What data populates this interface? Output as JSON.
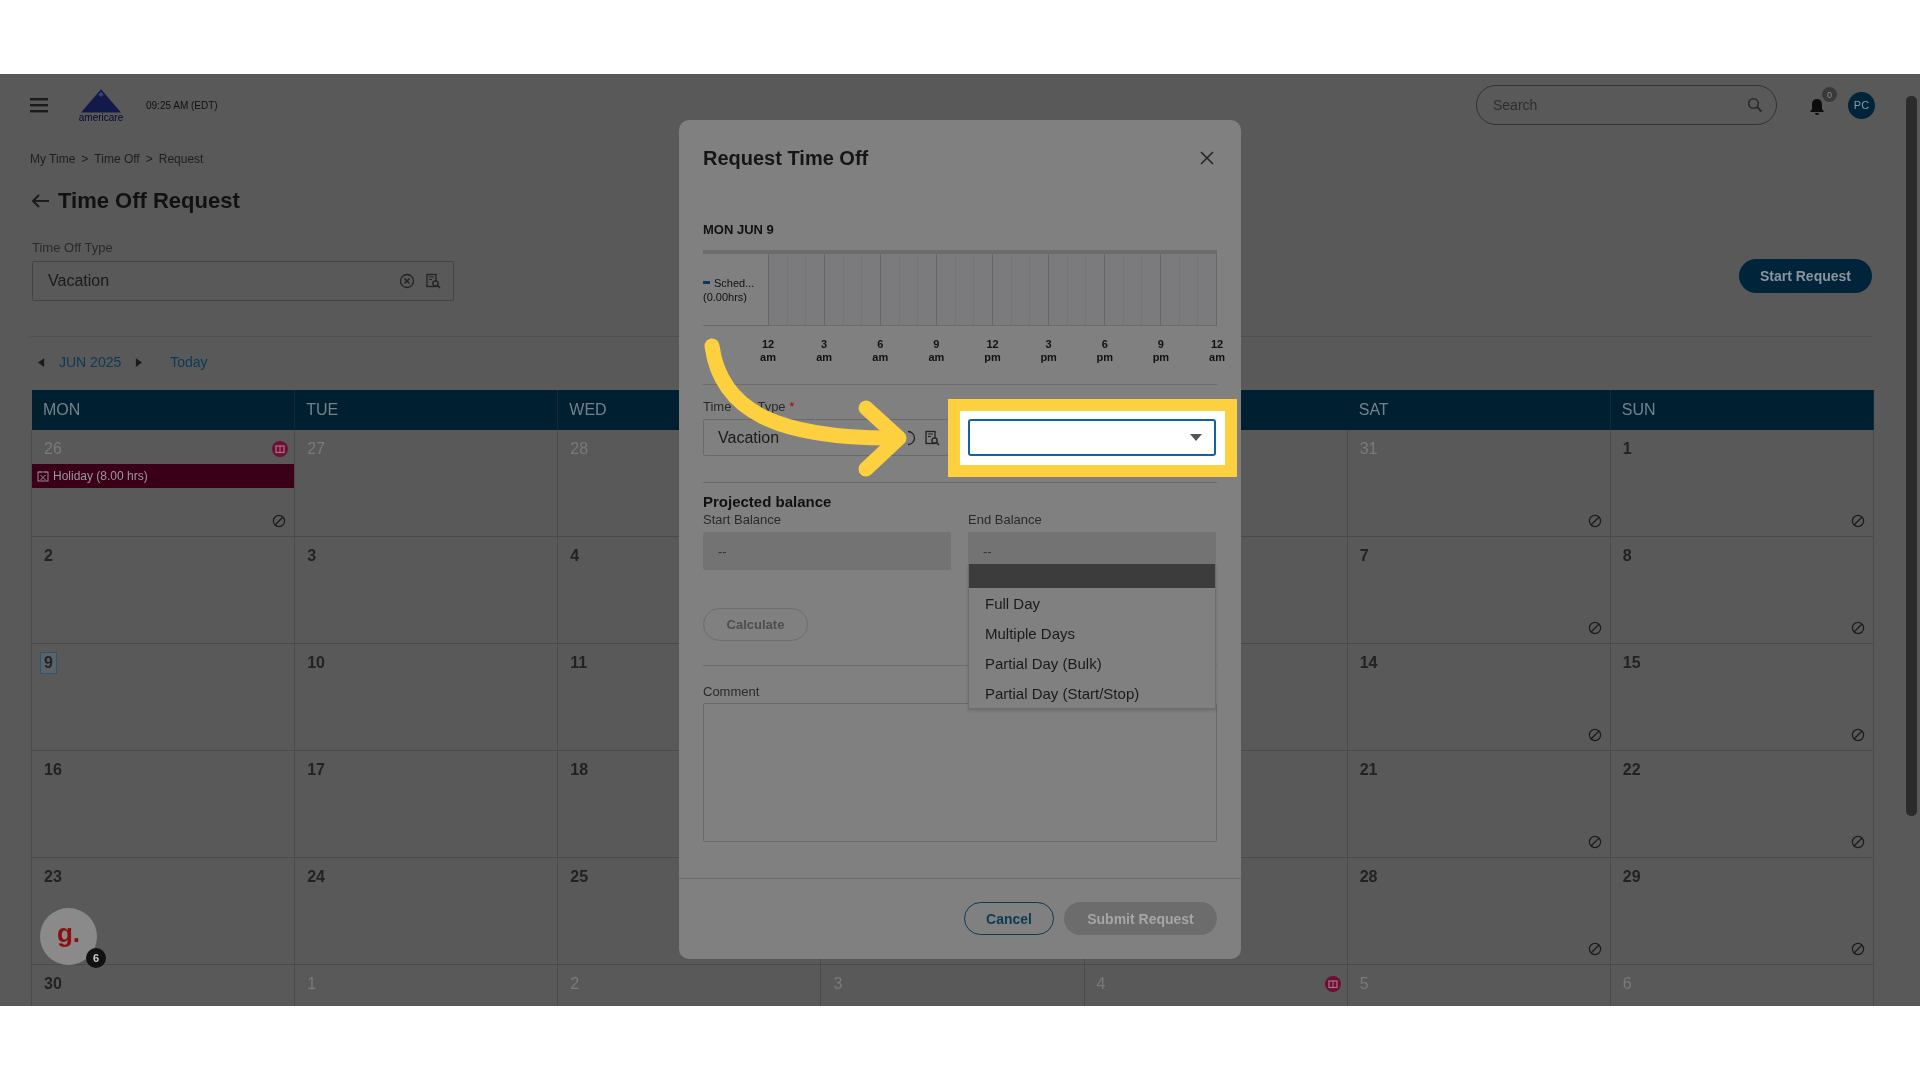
{
  "header": {
    "time": "09:25 AM (EDT)",
    "logo_text": "americare",
    "search": {
      "placeholder": "Search"
    },
    "notifications": "0",
    "avatar": "PC"
  },
  "breadcrumb": {
    "separator": ">",
    "items": [
      "My Time",
      "Time Off",
      "Request"
    ]
  },
  "page": {
    "title": "Time Off Request",
    "type_label": "Time Off Type",
    "type_value": "Vacation",
    "start_button": "Start Request"
  },
  "calendar": {
    "month": "JUN 2025",
    "today": "Today",
    "weekdays": [
      "MON",
      "TUE",
      "WED",
      "SAT",
      "SUN"
    ],
    "weeks": [
      [
        {
          "date": "26",
          "other_month": true,
          "selected": false,
          "blocked": true,
          "holiday": true,
          "event": "Holiday (8.00 hrs)"
        },
        {
          "date": "27",
          "other_month": true,
          "selected": false,
          "blocked": false,
          "holiday": false
        },
        {
          "date": "28",
          "other_month": true,
          "selected": false,
          "blocked": false,
          "holiday": false
        },
        {
          "date": "31",
          "other_month": true,
          "selected": false,
          "blocked": true,
          "holiday": false
        },
        {
          "date": "1",
          "other_month": false,
          "selected": false,
          "blocked": true,
          "holiday": false
        }
      ],
      [
        {
          "date": "2",
          "other_month": false,
          "selected": false,
          "blocked": false,
          "holiday": false
        },
        {
          "date": "3",
          "other_month": false,
          "selected": false,
          "blocked": false,
          "holiday": false
        },
        {
          "date": "4",
          "other_month": false,
          "selected": false,
          "blocked": false,
          "holiday": false
        },
        {
          "date": "7",
          "other_month": false,
          "selected": false,
          "blocked": true,
          "holiday": false
        },
        {
          "date": "8",
          "other_month": false,
          "selected": false,
          "blocked": true,
          "holiday": false
        }
      ],
      [
        {
          "date": "9",
          "other_month": false,
          "selected": true,
          "blocked": false,
          "holiday": false
        },
        {
          "date": "10",
          "other_month": false,
          "selected": false,
          "blocked": false,
          "holiday": false
        },
        {
          "date": "11",
          "other_month": false,
          "selected": false,
          "blocked": false,
          "holiday": false
        },
        {
          "date": "14",
          "other_month": false,
          "selected": false,
          "blocked": true,
          "holiday": false
        },
        {
          "date": "15",
          "other_month": false,
          "selected": false,
          "blocked": true,
          "holiday": false
        }
      ],
      [
        {
          "date": "16",
          "other_month": false,
          "selected": false,
          "blocked": false,
          "holiday": false
        },
        {
          "date": "17",
          "other_month": false,
          "selected": false,
          "blocked": false,
          "holiday": false
        },
        {
          "date": "18",
          "other_month": false,
          "selected": false,
          "blocked": false,
          "holiday": false
        },
        {
          "date": "21",
          "other_month": false,
          "selected": false,
          "blocked": true,
          "holiday": false
        },
        {
          "date": "22",
          "other_month": false,
          "selected": false,
          "blocked": true,
          "holiday": false
        }
      ],
      [
        {
          "date": "23",
          "other_month": false,
          "selected": false,
          "blocked": false,
          "holiday": false
        },
        {
          "date": "24",
          "other_month": false,
          "selected": false,
          "blocked": false,
          "holiday": false
        },
        {
          "date": "25",
          "other_month": false,
          "selected": false,
          "blocked": false,
          "holiday": false
        },
        {
          "date": "28",
          "other_month": false,
          "selected": false,
          "blocked": true,
          "holiday": false
        },
        {
          "date": "29",
          "other_month": false,
          "selected": false,
          "blocked": true,
          "holiday": false
        }
      ],
      [
        {
          "date": "30",
          "other_month": false,
          "selected": false,
          "blocked": false,
          "holiday": false
        },
        {
          "date": "1",
          "other_month": true,
          "selected": false,
          "blocked": false,
          "holiday": false
        },
        {
          "date": "2",
          "other_month": true,
          "selected": false,
          "blocked": false,
          "holiday": false
        },
        {
          "date": "3",
          "other_month": true,
          "selected": false,
          "blocked": false,
          "holiday": false
        },
        {
          "date": "4",
          "other_month": true,
          "selected": false,
          "blocked": false,
          "holiday": true
        },
        {
          "date": "5",
          "other_month": true,
          "selected": false,
          "blocked": false,
          "holiday": false
        },
        {
          "date": "6",
          "other_month": true,
          "selected": false,
          "blocked": false,
          "holiday": false
        }
      ]
    ]
  },
  "modal": {
    "title": "Request Time Off",
    "date": "MON JUN 9",
    "legend": "Sched...",
    "legend_hours": "(0.00hrs)",
    "hours": [
      {
        "hour": "12",
        "period": "am"
      },
      {
        "hour": "3",
        "period": "am"
      },
      {
        "hour": "6",
        "period": "am"
      },
      {
        "hour": "9",
        "period": "am"
      },
      {
        "hour": "12",
        "period": "pm"
      },
      {
        "hour": "3",
        "period": "pm"
      },
      {
        "hour": "6",
        "period": "pm"
      },
      {
        "hour": "9",
        "period": "pm"
      },
      {
        "hour": "12",
        "period": "am"
      }
    ],
    "type_label_parts": [
      "Time",
      "Type"
    ],
    "required_mark": "*",
    "type_value": "Vacation",
    "request_type": {
      "open": true,
      "blank_highlighted": true,
      "options": [
        "Full Day",
        "Multiple Days",
        "Partial Day (Bulk)",
        "Partial Day (Start/Stop)"
      ]
    },
    "balance_heading": "Projected balance",
    "start_label": "Start Balance",
    "start_value": "--",
    "end_label": "End Balance",
    "end_value": "--",
    "calculate": {
      "label": "Calculate",
      "disabled": true
    },
    "comment_label": "Comment",
    "cancel": "Cancel",
    "submit": {
      "label": "Submit Request",
      "disabled": true
    }
  },
  "helper": {
    "initial": "g.",
    "count": "6"
  }
}
